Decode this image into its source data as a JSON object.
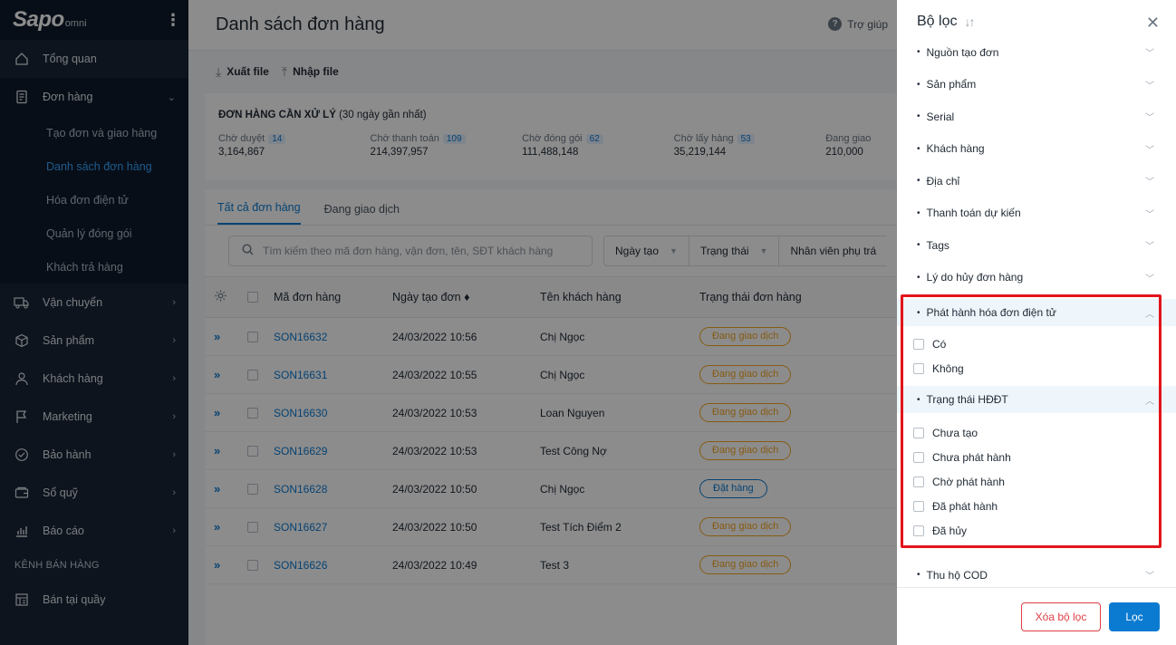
{
  "brand": {
    "logo": "Sapo",
    "logo_sub": "omni"
  },
  "sidebar": {
    "items": [
      {
        "label": "Tổng quan"
      },
      {
        "label": "Đơn hàng"
      },
      {
        "label": "Vận chuyển"
      },
      {
        "label": "Sản phẩm"
      },
      {
        "label": "Khách hàng"
      },
      {
        "label": "Marketing"
      },
      {
        "label": "Bảo hành"
      },
      {
        "label": "Sổ quỹ"
      },
      {
        "label": "Báo cáo"
      },
      {
        "label": "Bán tại quầy"
      }
    ],
    "sub_items": [
      {
        "label": "Tạo đơn và giao hàng"
      },
      {
        "label": "Danh sách đơn hàng"
      },
      {
        "label": "Hóa đơn điện tử"
      },
      {
        "label": "Quản lý đóng gói"
      },
      {
        "label": "Khách trả hàng"
      }
    ],
    "section_label": "KÊNH BÁN HÀNG"
  },
  "header": {
    "title": "Danh sách đơn hàng",
    "help": "Trợ giúp"
  },
  "actions": {
    "export": "Xuất file",
    "import": "Nhập file"
  },
  "pending": {
    "title_bold": "ĐƠN HÀNG CẦN XỬ LÝ",
    "title_rest": " (30 ngày gần nhất)",
    "cols": [
      {
        "label": "Chờ duyệt",
        "count": "14",
        "value": "3,164,867"
      },
      {
        "label": "Chờ thanh toán",
        "count": "109",
        "value": "214,397,957"
      },
      {
        "label": "Chờ đóng gói",
        "count": "62",
        "value": "111,488,148"
      },
      {
        "label": "Chờ lấy hàng",
        "count": "53",
        "value": "35,219,144"
      },
      {
        "label": "Đang giao",
        "count": "",
        "value": "210,000"
      }
    ]
  },
  "tabs": [
    {
      "label": "Tất cả đơn hàng"
    },
    {
      "label": "Đang giao dịch"
    }
  ],
  "filters": {
    "search_placeholder": "Tìm kiếm theo mã đơn hàng, vận đơn, tên, SĐT khách hàng",
    "date": "Ngày tạo",
    "status": "Trạng thái",
    "staff": "Nhân viên phụ trá"
  },
  "table": {
    "headers": {
      "code": "Mã đơn hàng",
      "date": "Ngày tạo đơn ♦",
      "customer": "Tên khách hàng",
      "status": "Trạng thái đơn hàng"
    },
    "rows": [
      {
        "code": "SON16632",
        "date": "24/03/2022 10:56",
        "customer": "Chị Ngọc",
        "status": "Đang giao dịch"
      },
      {
        "code": "SON16631",
        "date": "24/03/2022 10:55",
        "customer": "Chị Ngọc",
        "status": "Đang giao dịch"
      },
      {
        "code": "SON16630",
        "date": "24/03/2022 10:53",
        "customer": "Loan Nguyen",
        "status": "Đang giao dịch"
      },
      {
        "code": "SON16629",
        "date": "24/03/2022 10:53",
        "customer": "Test Công Nợ",
        "status": "Đang giao dịch"
      },
      {
        "code": "SON16628",
        "date": "24/03/2022 10:50",
        "customer": "Chị Ngọc",
        "status": "Đặt hàng"
      },
      {
        "code": "SON16627",
        "date": "24/03/2022 10:50",
        "customer": "Test Tích Điểm 2",
        "status": "Đang giao dịch"
      },
      {
        "code": "SON16626",
        "date": "24/03/2022 10:49",
        "customer": "Test 3",
        "status": "Đang giao dịch"
      }
    ]
  },
  "panel": {
    "title": "Bộ lọc",
    "items_top": [
      {
        "label": "Nguồn tạo đơn"
      },
      {
        "label": "Sản phẩm"
      },
      {
        "label": "Serial"
      },
      {
        "label": "Khách hàng"
      },
      {
        "label": "Địa chỉ"
      },
      {
        "label": "Thanh toán dự kiến"
      },
      {
        "label": "Tags"
      },
      {
        "label": "Lý do hủy đơn hàng"
      }
    ],
    "einvoice": {
      "label": "Phát hành hóa đơn điện tử",
      "options": [
        "Có",
        "Không"
      ]
    },
    "einvoice_status": {
      "label": "Trạng thái HĐĐT",
      "options": [
        "Chưa tạo",
        "Chưa phát hành",
        "Chờ phát hành",
        "Đã phát hành",
        "Đã hủy"
      ]
    },
    "cod": {
      "label": "Thu hộ COD"
    },
    "clear": "Xóa bộ lọc",
    "apply": "Lọc"
  },
  "colors": {
    "sidebar_bg": "#182537",
    "accent": "#0b7ad1",
    "warning": "#f5a623",
    "danger": "#e03e46",
    "highlight": "#e3141b"
  }
}
